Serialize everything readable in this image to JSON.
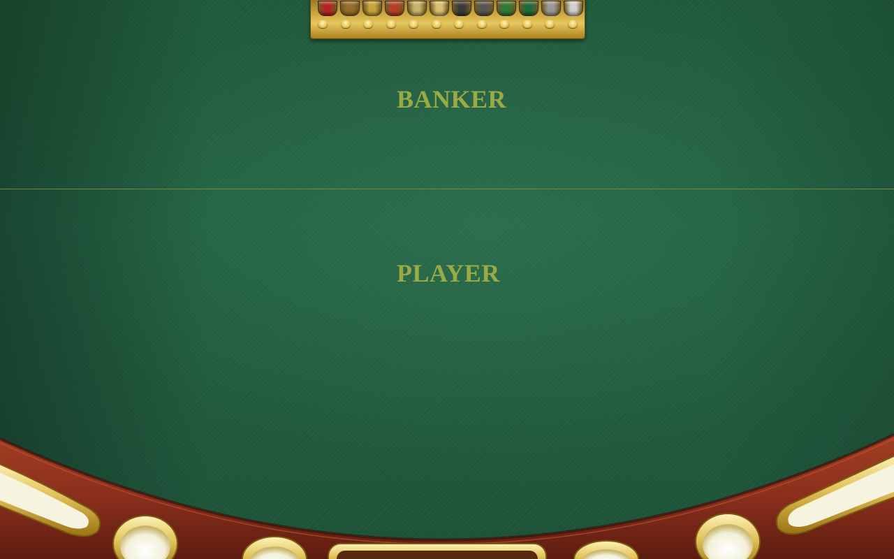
{
  "table": {
    "banker_label": "BANKER",
    "player_label": "PLAYER"
  },
  "colors": {
    "felt": "#215f42",
    "label": "#9aaa45",
    "divider": "#7d8f3b",
    "rail_wood": "#8a2f1c",
    "gold": "#e2c25a"
  },
  "chip_tray": {
    "chip_colors": [
      "#b52424",
      "#9a6b2a",
      "#c9a23a",
      "#b83d2a",
      "#c5b36a",
      "#d8c070",
      "#3a3a3a",
      "#555555",
      "#2f7a3a",
      "#1e6a3a",
      "#9a9a9a",
      "#cfcfcf"
    ]
  }
}
